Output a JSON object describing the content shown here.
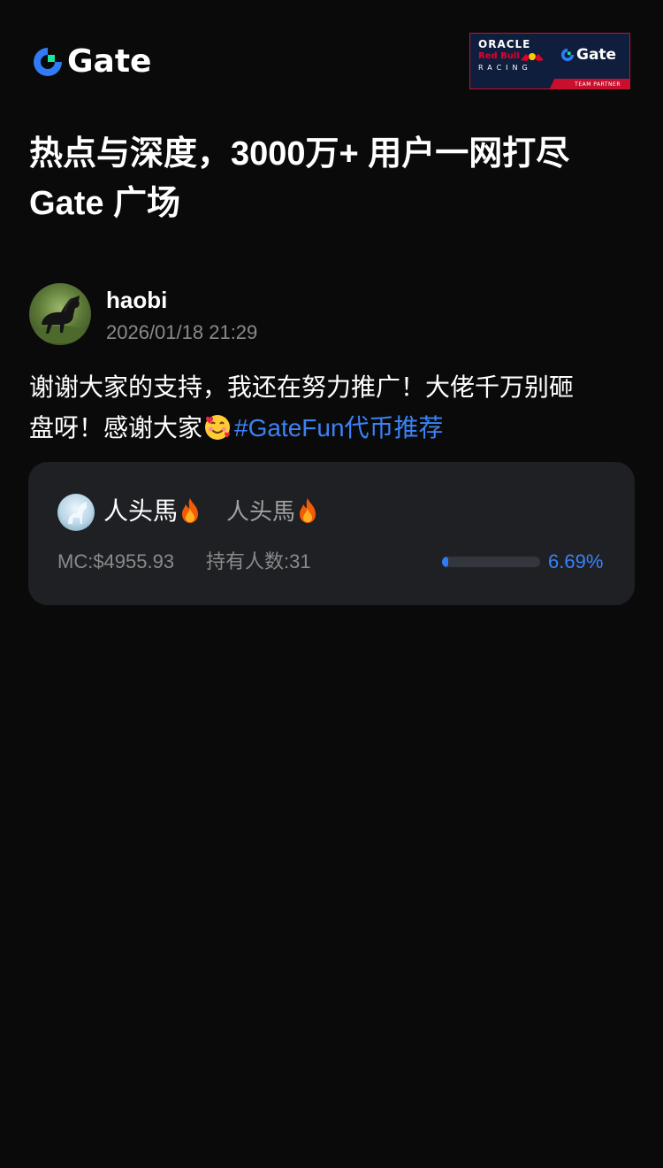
{
  "header": {
    "brand_name": "Gate",
    "partner": {
      "line1": "ORACLE",
      "line2": "Red Bull",
      "line3": "RACING",
      "brand": "Gate",
      "tag": "TEAM PARTNER"
    }
  },
  "headline": {
    "line1": "热点与深度，3000万+ 用户一网打尽",
    "line2": "Gate 广场"
  },
  "post": {
    "author": "haobi",
    "time": "2026/01/18 21:29",
    "body_line1": "谢谢大家的支持，我还在努力推广！大佬千万别砸",
    "body_line2_prefix": "盘呀！感谢大家",
    "hashtag": "#GateFun代币推荐"
  },
  "token": {
    "name": "人头馬",
    "ticker": "人头馬",
    "market_cap": "MC:$4955.93",
    "holders": "持有人数:31",
    "progress_label": "6.69%",
    "progress_fraction": 0.0669
  },
  "colors": {
    "background": "#0a0a0a",
    "card": "#1e2024",
    "accent": "#3b82f6",
    "muted": "#8a8a8a",
    "partner_red": "#c8102e",
    "partner_navy": "#0f1e3c"
  },
  "icons": {
    "brand": "gate-logo-icon",
    "emoji": "smiling-face-with-hearts-icon",
    "fire": "fire-icon"
  }
}
